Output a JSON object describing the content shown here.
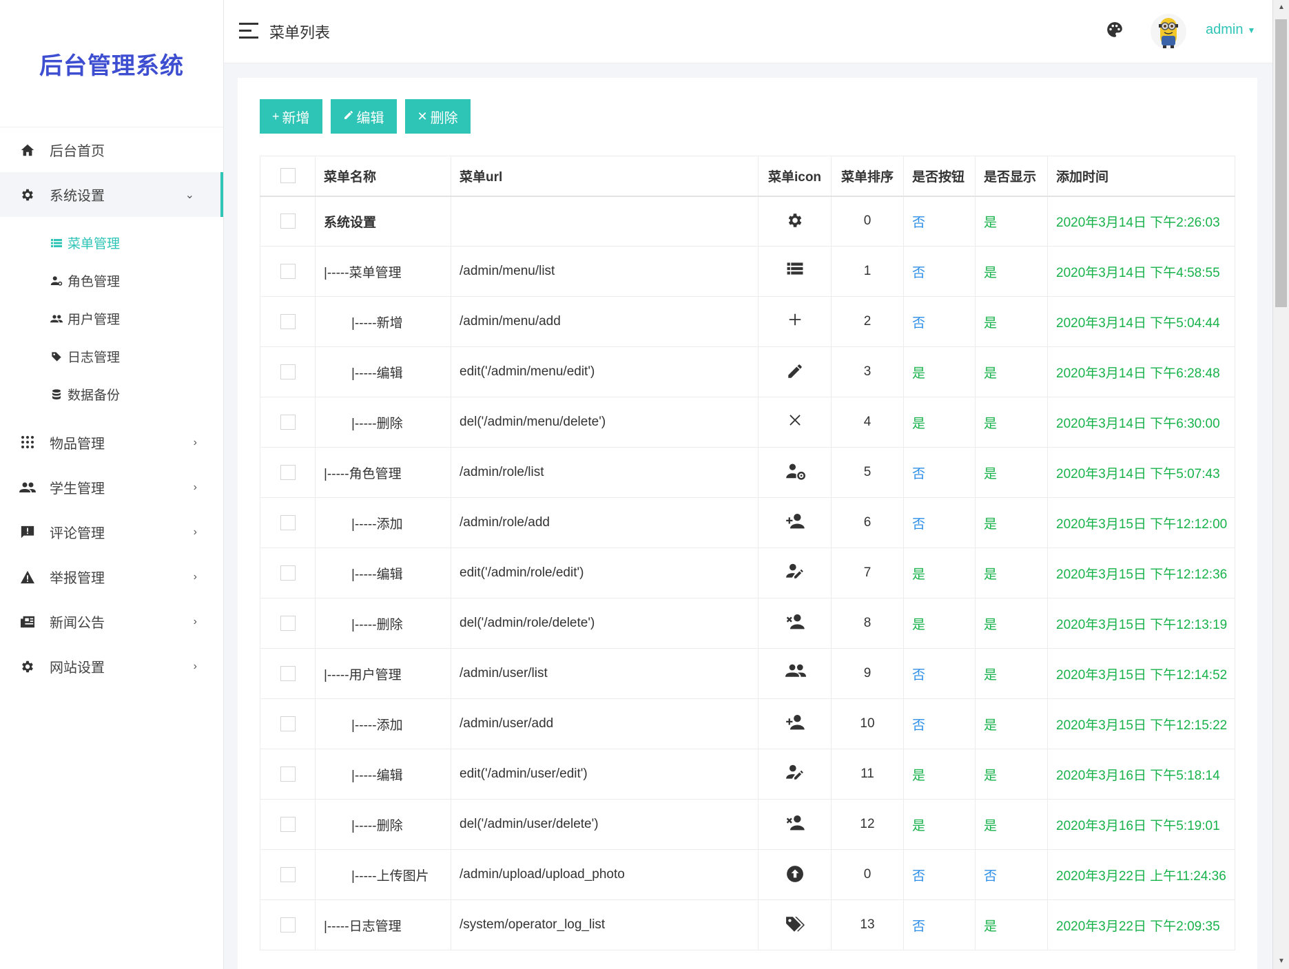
{
  "app": {
    "logo": "后台管理系统",
    "page_title": "菜单列表",
    "user": "admin"
  },
  "colors": {
    "accent": "#2ec4b6",
    "logo": "#3d4ed0",
    "no": "#2e8fe8",
    "yes": "#18b24b"
  },
  "sidebar": {
    "items": [
      {
        "label": "后台首页",
        "icon": "home-icon"
      },
      {
        "label": "系统设置",
        "icon": "gear-icon",
        "open": true
      },
      {
        "label": "物品管理",
        "icon": "grid-dots-icon"
      },
      {
        "label": "学生管理",
        "icon": "users-icon"
      },
      {
        "label": "评论管理",
        "icon": "comment-alert-icon"
      },
      {
        "label": "举报管理",
        "icon": "warning-icon"
      },
      {
        "label": "新闻公告",
        "icon": "newspaper-icon"
      },
      {
        "label": "网站设置",
        "icon": "gear-icon"
      }
    ],
    "sub_items": [
      {
        "label": "菜单管理",
        "icon": "list-icon",
        "active": true
      },
      {
        "label": "角色管理",
        "icon": "user-cog-icon"
      },
      {
        "label": "用户管理",
        "icon": "users-icon"
      },
      {
        "label": "日志管理",
        "icon": "tag-icon"
      },
      {
        "label": "数据备份",
        "icon": "database-icon"
      }
    ]
  },
  "toolbar": {
    "add_label": "新增",
    "edit_label": "编辑",
    "delete_label": "删除"
  },
  "table": {
    "headers": [
      "菜单名称",
      "菜单url",
      "菜单icon",
      "菜单排序",
      "是否按钮",
      "是否显示",
      "添加时间"
    ],
    "rows": [
      {
        "name": "系统设置",
        "url": "",
        "icon": "gear-icon",
        "sort": "0",
        "is_button": "否",
        "is_show": "是",
        "time": "2020年3月14日 下午2:26:03",
        "level": 0
      },
      {
        "name": "|-----菜单管理",
        "url": "/admin/menu/list",
        "icon": "list-icon",
        "sort": "1",
        "is_button": "否",
        "is_show": "是",
        "time": "2020年3月14日 下午4:58:55",
        "level": 1
      },
      {
        "name": "|-----新增",
        "url": "/admin/menu/add",
        "icon": "plus-icon",
        "sort": "2",
        "is_button": "否",
        "is_show": "是",
        "time": "2020年3月14日 下午5:04:44",
        "level": 2
      },
      {
        "name": "|-----编辑",
        "url": "edit('/admin/menu/edit')",
        "icon": "pencil-icon",
        "sort": "3",
        "is_button": "是",
        "is_show": "是",
        "time": "2020年3月14日 下午6:28:48",
        "level": 2
      },
      {
        "name": "|-----删除",
        "url": "del('/admin/menu/delete')",
        "icon": "close-icon",
        "sort": "4",
        "is_button": "是",
        "is_show": "是",
        "time": "2020年3月14日 下午6:30:00",
        "level": 2
      },
      {
        "name": "|-----角色管理",
        "url": "/admin/role/list",
        "icon": "user-cog-icon",
        "sort": "5",
        "is_button": "否",
        "is_show": "是",
        "time": "2020年3月14日 下午5:07:43",
        "level": 1
      },
      {
        "name": "|-----添加",
        "url": "/admin/role/add",
        "icon": "user-plus-icon",
        "sort": "6",
        "is_button": "否",
        "is_show": "是",
        "time": "2020年3月15日 下午12:12:00",
        "level": 2
      },
      {
        "name": "|-----编辑",
        "url": "edit('/admin/role/edit')",
        "icon": "user-edit-icon",
        "sort": "7",
        "is_button": "是",
        "is_show": "是",
        "time": "2020年3月15日 下午12:12:36",
        "level": 2
      },
      {
        "name": "|-----删除",
        "url": "del('/admin/role/delete')",
        "icon": "user-remove-icon",
        "sort": "8",
        "is_button": "是",
        "is_show": "是",
        "time": "2020年3月15日 下午12:13:19",
        "level": 2
      },
      {
        "name": "|-----用户管理",
        "url": "/admin/user/list",
        "icon": "users-icon",
        "sort": "9",
        "is_button": "否",
        "is_show": "是",
        "time": "2020年3月15日 下午12:14:52",
        "level": 1
      },
      {
        "name": "|-----添加",
        "url": "/admin/user/add",
        "icon": "user-plus-icon",
        "sort": "10",
        "is_button": "否",
        "is_show": "是",
        "time": "2020年3月15日 下午12:15:22",
        "level": 2
      },
      {
        "name": "|-----编辑",
        "url": "edit('/admin/user/edit')",
        "icon": "user-edit-icon",
        "sort": "11",
        "is_button": "是",
        "is_show": "是",
        "time": "2020年3月16日 下午5:18:14",
        "level": 2
      },
      {
        "name": "|-----删除",
        "url": "del('/admin/user/delete')",
        "icon": "user-remove-icon",
        "sort": "12",
        "is_button": "是",
        "is_show": "是",
        "time": "2020年3月16日 下午5:19:01",
        "level": 2
      },
      {
        "name": "|-----上传图片",
        "url": "/admin/upload/upload_photo",
        "icon": "upload-circle-icon",
        "sort": "0",
        "is_button": "否",
        "is_show": "否",
        "time": "2020年3月22日 上午11:24:36",
        "level": 2
      },
      {
        "name": "|-----日志管理",
        "url": "/system/operator_log_list",
        "icon": "tags-icon",
        "sort": "13",
        "is_button": "否",
        "is_show": "是",
        "time": "2020年3月22日 下午2:09:35",
        "level": 1
      }
    ]
  }
}
